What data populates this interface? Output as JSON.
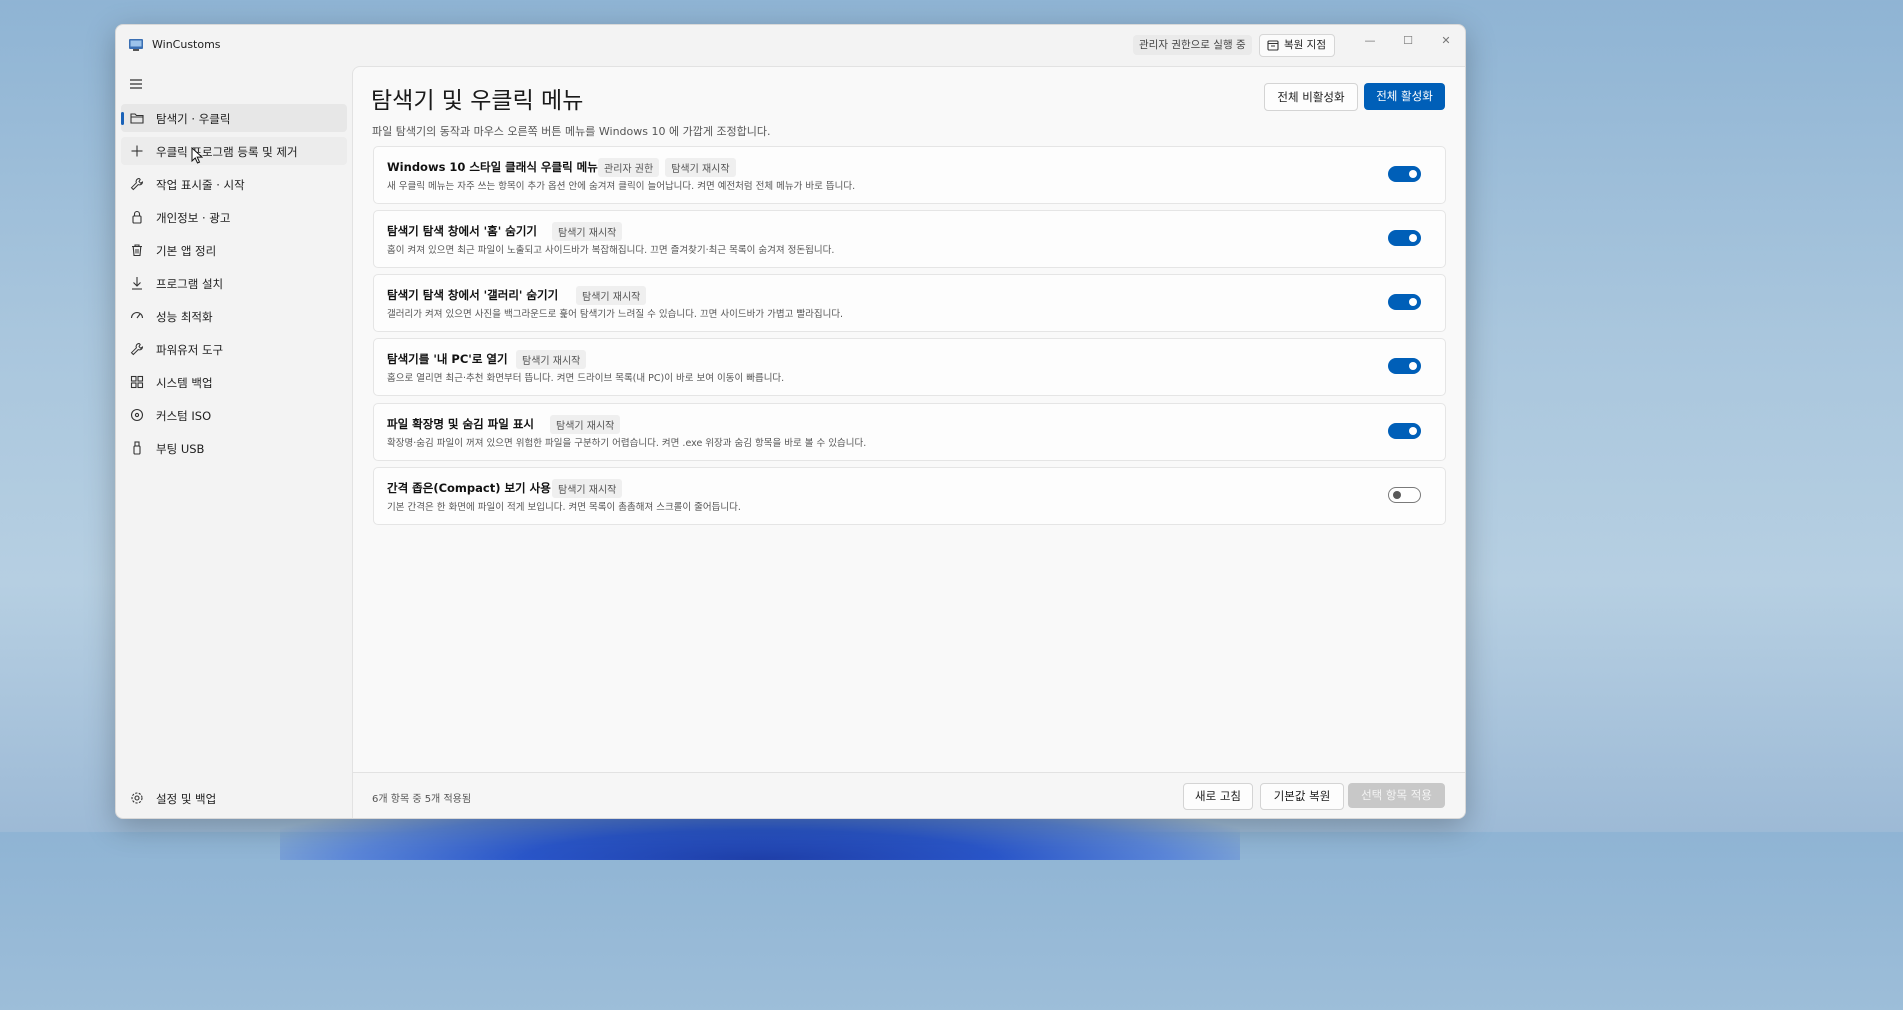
{
  "window": {
    "title": "WinCustoms",
    "admin_badge": "관리자 권한으로 실행 중",
    "restore_point_label": "복원 지점",
    "controls": {
      "minimize": "—",
      "maximize": "☐",
      "close": "✕"
    }
  },
  "sidebar": {
    "items": [
      {
        "label": "탐색기 · 우클릭",
        "icon": "folder-icon"
      },
      {
        "label": "우클릭 프로그램 등록 및 제거",
        "icon": "plus-icon"
      },
      {
        "label": "작업 표시줄 · 시작",
        "icon": "wrench-icon"
      },
      {
        "label": "개인정보 · 광고",
        "icon": "lock-icon"
      },
      {
        "label": "기본 앱 정리",
        "icon": "trash-icon"
      },
      {
        "label": "프로그램 설치",
        "icon": "download-icon"
      },
      {
        "label": "성능 최적화",
        "icon": "gauge-icon"
      },
      {
        "label": "파워유저 도구",
        "icon": "wrench-icon"
      },
      {
        "label": "시스템 백업",
        "icon": "grid-icon"
      },
      {
        "label": "커스텀 ISO",
        "icon": "disc-icon"
      },
      {
        "label": "부팅 USB",
        "icon": "usb-icon"
      }
    ],
    "settings_label": "설정 및 백업"
  },
  "main": {
    "title": "탐색기 및 우클릭 메뉴",
    "description": "파일 탐색기의 동작과 마우스 오른쪽 버튼 메뉴를 Windows 10 에 가깝게 조정합니다.",
    "disable_all_label": "전체 비활성화",
    "enable_all_label": "전체 활성화",
    "cards": [
      {
        "title": "Windows 10 스타일 클래식 우클릭 메뉴",
        "tags": [
          "관리자 권한",
          "탐색기 재시작"
        ],
        "description": "새 우클릭 메뉴는 자주 쓰는 항목이 추가 옵션 안에 숨겨져 클릭이 늘어납니다. 켜면 예전처럼 전체 메뉴가 바로 뜹니다.",
        "enabled": true
      },
      {
        "title": "탐색기 탐색 창에서 '홈' 숨기기",
        "tags": [
          "탐색기 재시작"
        ],
        "description": "홈이 켜져 있으면 최근 파일이 노출되고 사이드바가 복잡해집니다. 끄면 즐겨찾기·최근 목록이 숨겨져 정돈됩니다.",
        "enabled": true
      },
      {
        "title": "탐색기 탐색 창에서 '갤러리' 숨기기",
        "tags": [
          "탐색기 재시작"
        ],
        "description": "갤러리가 켜져 있으면 사진을 백그라운드로 훑어 탐색기가 느려질 수 있습니다. 끄면 사이드바가 가볍고 빨라집니다.",
        "enabled": true
      },
      {
        "title": "탐색기를 '내 PC'로 열기",
        "tags": [
          "탐색기 재시작"
        ],
        "description": "홈으로 열리면 최근·추천 화면부터 뜹니다. 켜면 드라이브 목록(내 PC)이 바로 보여 이동이 빠릅니다.",
        "enabled": true
      },
      {
        "title": "파일 확장명 및 숨김 파일 표시",
        "tags": [
          "탐색기 재시작"
        ],
        "description": "확장명·숨김 파일이 꺼져 있으면 위험한 파일을 구분하기 어렵습니다. 켜면 .exe 위장과 숨김 항목을 바로 볼 수 있습니다.",
        "enabled": true
      },
      {
        "title": "간격 좁은(Compact) 보기 사용",
        "tags": [
          "탐색기 재시작"
        ],
        "description": "기본 간격은 한 화면에 파일이 적게 보입니다. 켜면 목록이 촘촘해져 스크롤이 줄어듭니다.",
        "enabled": false
      }
    ]
  },
  "footer": {
    "status": "6개 항목 중 5개 적용됨",
    "refresh_label": "새로 고침",
    "reset_label": "기본값 복원",
    "apply_label": "선택 항목 적용"
  },
  "colors": {
    "accent": "#005fb8",
    "active_indicator": "#1a62b8"
  }
}
